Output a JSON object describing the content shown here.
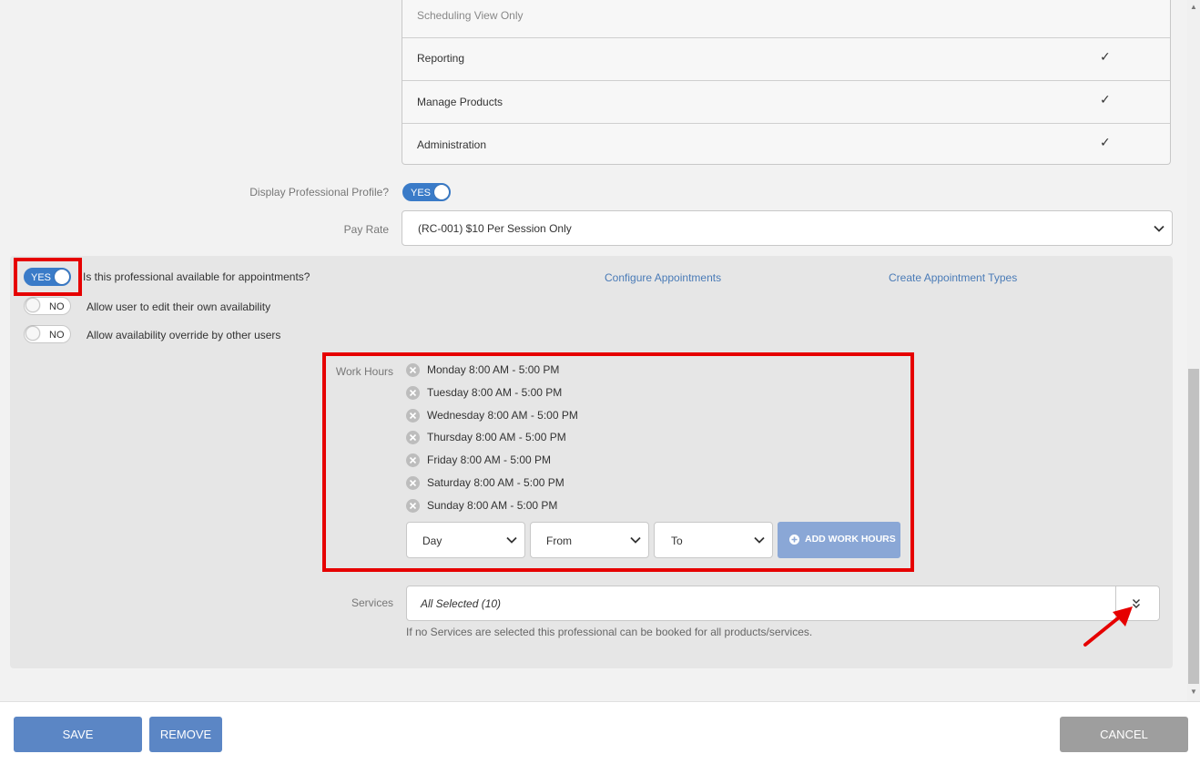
{
  "permissions": [
    {
      "label": "Scheduling View Only",
      "checked": false,
      "muted": true
    },
    {
      "label": "Reporting",
      "checked": true,
      "muted": false
    },
    {
      "label": "Manage Products",
      "checked": true,
      "muted": false
    },
    {
      "label": "Administration",
      "checked": true,
      "muted": false
    }
  ],
  "check_glyph": "✓",
  "display_profile": {
    "label": "Display Professional Profile?",
    "toggle": "YES"
  },
  "pay_rate": {
    "label": "Pay Rate",
    "value": "(RC-001) $10 Per Session Only"
  },
  "appointments": {
    "available_toggle": "YES",
    "available_label": "Is this professional available for appointments?",
    "edit_toggle": "NO",
    "edit_label": "Allow user to edit their own availability",
    "override_toggle": "NO",
    "override_label": "Allow availability override by other users",
    "configure_link": "Configure Appointments",
    "create_types_link": "Create Appointment Types"
  },
  "work_hours": {
    "label": "Work Hours",
    "items": [
      "Monday 8:00 AM - 5:00 PM",
      "Tuesday 8:00 AM - 5:00 PM",
      "Wednesday 8:00 AM - 5:00 PM",
      "Thursday 8:00 AM - 5:00 PM",
      "Friday 8:00 AM - 5:00 PM",
      "Saturday 8:00 AM - 5:00 PM",
      "Sunday 8:00 AM - 5:00 PM"
    ],
    "day_select": "Day",
    "from_select": "From",
    "to_select": "To",
    "add_button": "ADD WORK HOURS"
  },
  "services": {
    "label": "Services",
    "value": "All Selected (10)",
    "hint": "If no Services are selected this professional can be booked for all products/services."
  },
  "footer": {
    "save": "SAVE",
    "remove": "REMOVE",
    "cancel": "CANCEL"
  },
  "colors": {
    "primary_button": "#5b86c5",
    "add_button": "#8aa7d6",
    "cancel_button": "#9e9e9e",
    "toggle_on": "#3a7bc8",
    "link": "#4a7bb7",
    "highlight": "#e60000"
  }
}
